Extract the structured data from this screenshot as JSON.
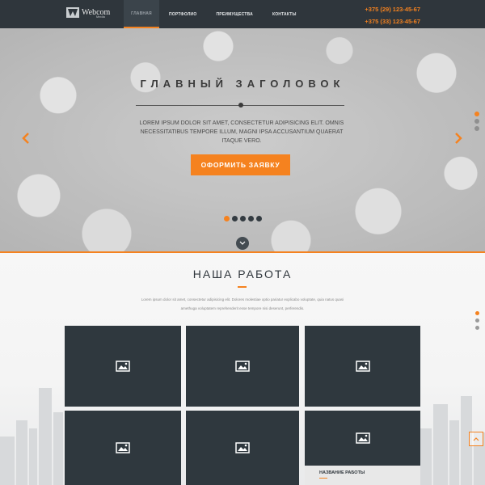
{
  "header": {
    "logo_text": "Webcom",
    "logo_sub": "Media",
    "nav": [
      "ГЛАВНАЯ",
      "ПОРТФОЛИО",
      "ПРЕИМУЩЕСТВА",
      "КОНТАКТЫ"
    ],
    "phones": [
      "+375 (29) 123-45-67",
      "+375 (33) 123-45-67"
    ]
  },
  "hero": {
    "title": "ГЛАВНЫЙ ЗАГОЛОВОК",
    "text": "LOREM IPSUM DOLOR SIT AMET, CONSECTETUR ADIPISICING ELIT. OMNIS NECESSITATIBUS TEMPORE ILLUM, MAGNI IPSA ACCUSANTIUM QUAERAT ITAQUE VERO.",
    "cta_label": "ОФОРМИТЬ ЗАЯВКУ",
    "slides_count": 5,
    "active_slide": 1
  },
  "works": {
    "title": "НАША РАБОТА",
    "text": "Lorem ipsum dolor sit amet, consectetur adipisicing elit. Dolores molestiae optio pariatur explicabo voluptate, quia natus quasi amethuga voluptatem reprehenderit esse tempore nisi deserunt, perferendis.",
    "caption": "НАЗВАНИЕ РАБОТЫ"
  },
  "colors": {
    "accent": "#f5821f",
    "dark": "#2f363c"
  }
}
